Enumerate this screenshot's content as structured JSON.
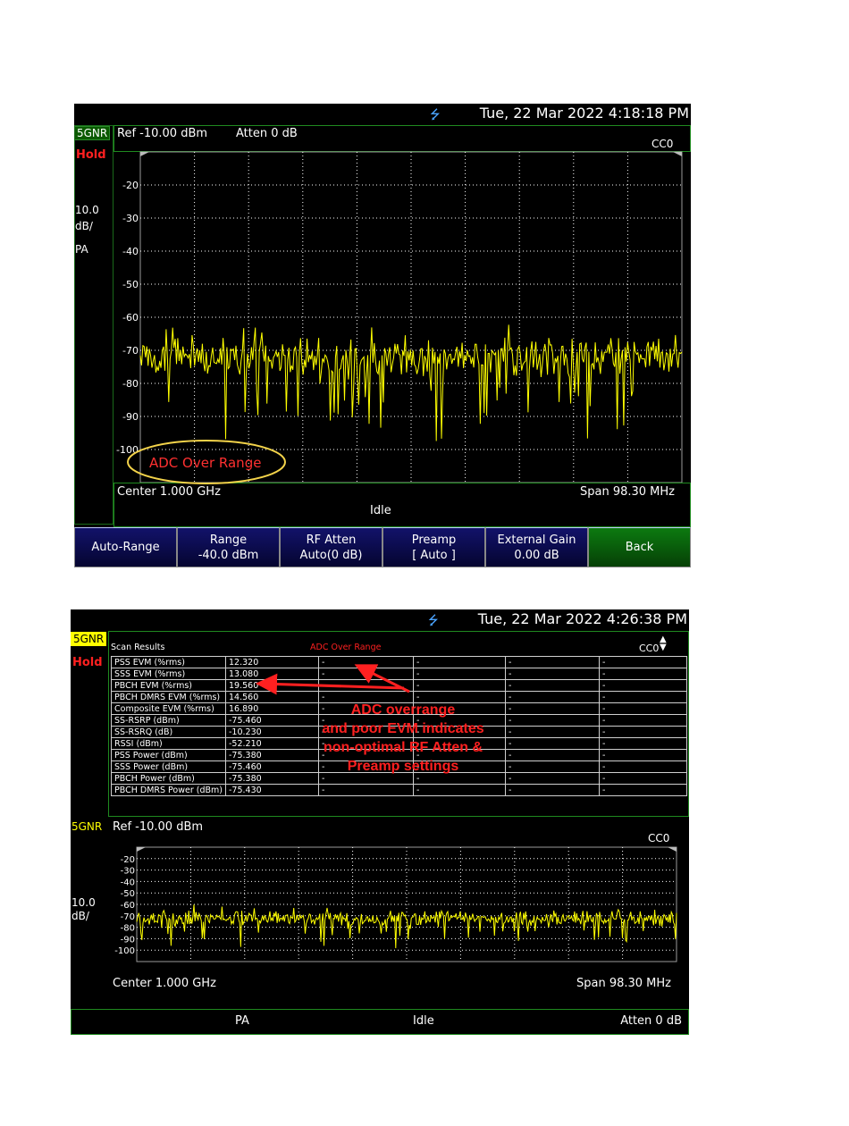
{
  "screen1": {
    "datetime": "Tue, 22 Mar 2022 4:18:18 PM",
    "mode": "5GNR",
    "hold": "Hold",
    "scale_value": "10.0",
    "scale_unit": "dB/",
    "preamp_label": "PA",
    "ref_level": "Ref -10.00  dBm",
    "atten": "Atten 0  dB",
    "carrier": "CC0",
    "y_ticks": [
      "-20",
      "-30",
      "-40",
      "-50",
      "-60",
      "-70",
      "-80",
      "-90",
      "-100"
    ],
    "center": "Center 1.000 GHz",
    "span": "Span 98.30 MHz",
    "status": "Idle",
    "annotation": "ADC Over Range",
    "softkeys": [
      {
        "line1": "Auto-Range",
        "line2": ""
      },
      {
        "line1": "Range",
        "line2": "-40.0 dBm"
      },
      {
        "line1": "RF Atten",
        "line2": "Auto(0 dB)"
      },
      {
        "line1": "Preamp",
        "line2": "[ Auto ]"
      },
      {
        "line1": "External Gain",
        "line2": "0.00 dB"
      },
      {
        "line1": "Back",
        "line2": ""
      }
    ]
  },
  "screen2": {
    "datetime": "Tue, 22 Mar 2022 4:26:38 PM",
    "mode": "5GNR",
    "hold": "Hold",
    "scan_title": "Scan Results",
    "adc_warning": "ADC Over Range",
    "carrier": "CC0",
    "scan_rows": [
      {
        "label": "PSS EVM (%rms)",
        "value": "12.320"
      },
      {
        "label": "SSS EVM (%rms)",
        "value": "13.080"
      },
      {
        "label": "PBCH EVM (%rms)",
        "value": "19.560"
      },
      {
        "label": "PBCH DMRS EVM (%rms)",
        "value": "14.560"
      },
      {
        "label": "Composite EVM (%rms)",
        "value": "16.890"
      },
      {
        "label": "SS-RSRP (dBm)",
        "value": "-75.460"
      },
      {
        "label": "SS-RSRQ (dB)",
        "value": "-10.230"
      },
      {
        "label": "RSSI (dBm)",
        "value": "-52.210"
      },
      {
        "label": "PSS Power (dBm)",
        "value": "-75.380"
      },
      {
        "label": "SSS Power (dBm)",
        "value": "-75.460"
      },
      {
        "label": "PBCH Power (dBm)",
        "value": "-75.380"
      },
      {
        "label": "PBCH DMRS Power (dBm)",
        "value": "-75.430"
      }
    ],
    "empty_cell": "-",
    "annotation_lines": [
      "ADC overrange",
      "and poor EVM indicates",
      "non-optimal RF Atten &",
      "Preamp settings"
    ],
    "mode_lower": "5GNR",
    "ref_level": "Ref -10.00  dBm",
    "carrier_lower": "CC0",
    "scale_value": "10.0",
    "scale_unit": "dB/",
    "y_ticks": [
      "-20",
      "-30",
      "-40",
      "-50",
      "-60",
      "-70",
      "-80",
      "-90",
      "-100"
    ],
    "center": "Center 1.000 GHz",
    "span": "Span 98.30 MHz",
    "preamp_label": "PA",
    "status": "Idle",
    "atten": "Atten 0  dB"
  },
  "colors": {
    "trace": "#ffff00",
    "annotation": "#ff2020",
    "grid": "#ffffff",
    "frame": "#1f8a1f"
  }
}
